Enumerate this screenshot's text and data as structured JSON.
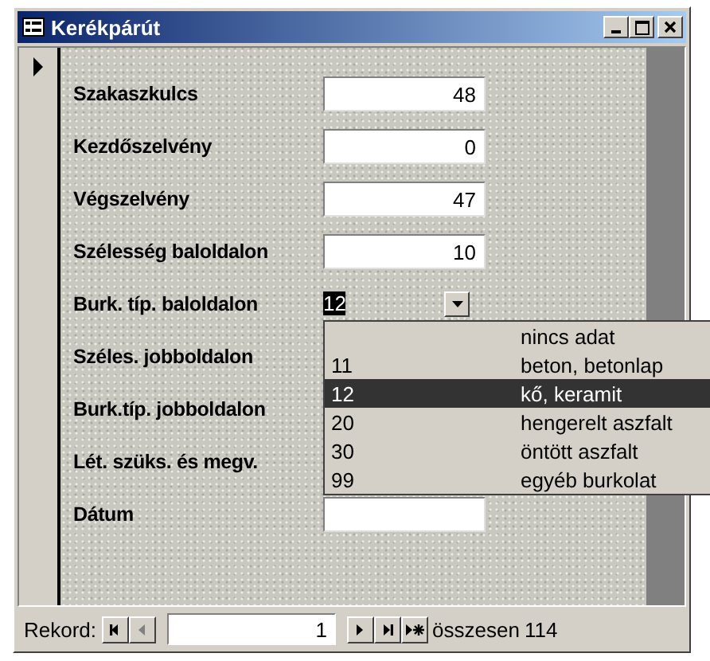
{
  "window": {
    "title": "Kerékpárút"
  },
  "fields": [
    {
      "label": "Szakaszkulcs",
      "kind": "text",
      "value": "48"
    },
    {
      "label": "Kezdőszelvény",
      "kind": "text",
      "value": "0"
    },
    {
      "label": "Végszelvény",
      "kind": "text",
      "value": "47"
    },
    {
      "label": "Szélesség baloldalon",
      "kind": "text",
      "value": "10"
    },
    {
      "label": "Burk. típ. baloldalon",
      "kind": "combo",
      "value": "12"
    },
    {
      "label": "Széles. jobboldalon",
      "kind": "covered"
    },
    {
      "label": "Burk.típ. jobboldalon",
      "kind": "covered"
    },
    {
      "label": "Lét. szüks. és megv.",
      "kind": "covered"
    },
    {
      "label": "Dátum",
      "kind": "text"
    }
  ],
  "dropdown": [
    {
      "description": "nincs adat",
      "selected": false
    },
    {
      "code": "11",
      "description": "beton, betonlap",
      "selected": false
    },
    {
      "code": "12",
      "description": "kő, keramit",
      "selected": true
    },
    {
      "code": "20",
      "description": "hengerelt aszfalt",
      "selected": false
    },
    {
      "code": "30",
      "description": "öntött aszfalt",
      "selected": false
    },
    {
      "code": "99",
      "description": "egyéb burkolat",
      "selected": false
    }
  ],
  "navigation": {
    "label": "Rekord:",
    "current": "1",
    "total_label": "összesen",
    "total": "114"
  }
}
